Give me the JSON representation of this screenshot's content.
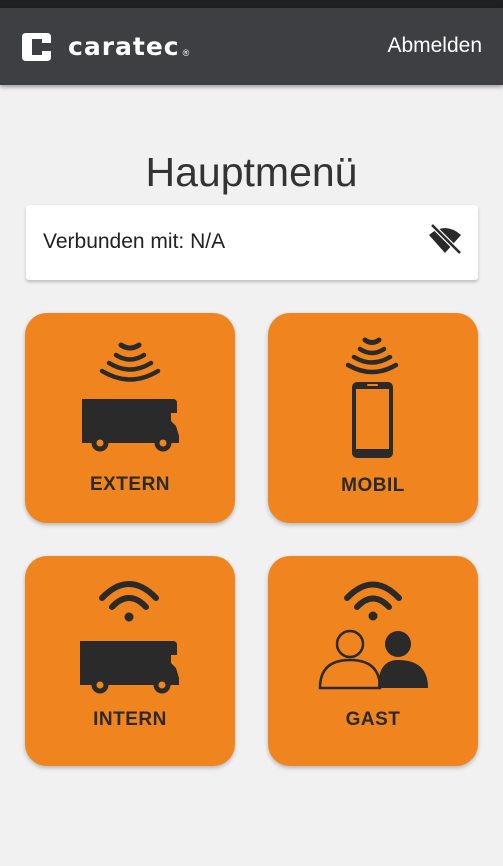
{
  "header": {
    "brand": "caratec",
    "brand_registered": "®",
    "logout_label": "Abmelden"
  },
  "page": {
    "title": "Hauptmenü"
  },
  "connection": {
    "status_text": "Verbunden mit: N/A",
    "status_icon": "wifi-off-icon"
  },
  "tiles": [
    {
      "label": "EXTERN",
      "icons": [
        "broadcast-icon",
        "motorhome-icon"
      ]
    },
    {
      "label": "MOBIL",
      "icons": [
        "broadcast-icon",
        "smartphone-icon"
      ]
    },
    {
      "label": "INTERN",
      "icons": [
        "wifi-icon",
        "motorhome-icon"
      ]
    },
    {
      "label": "GAST",
      "icons": [
        "wifi-icon",
        "guests-icon"
      ]
    }
  ],
  "colors": {
    "appbar": "#3d3f42",
    "background": "#f1f1f1",
    "tile": "#f0841f",
    "icon": "#2a2a2a"
  }
}
